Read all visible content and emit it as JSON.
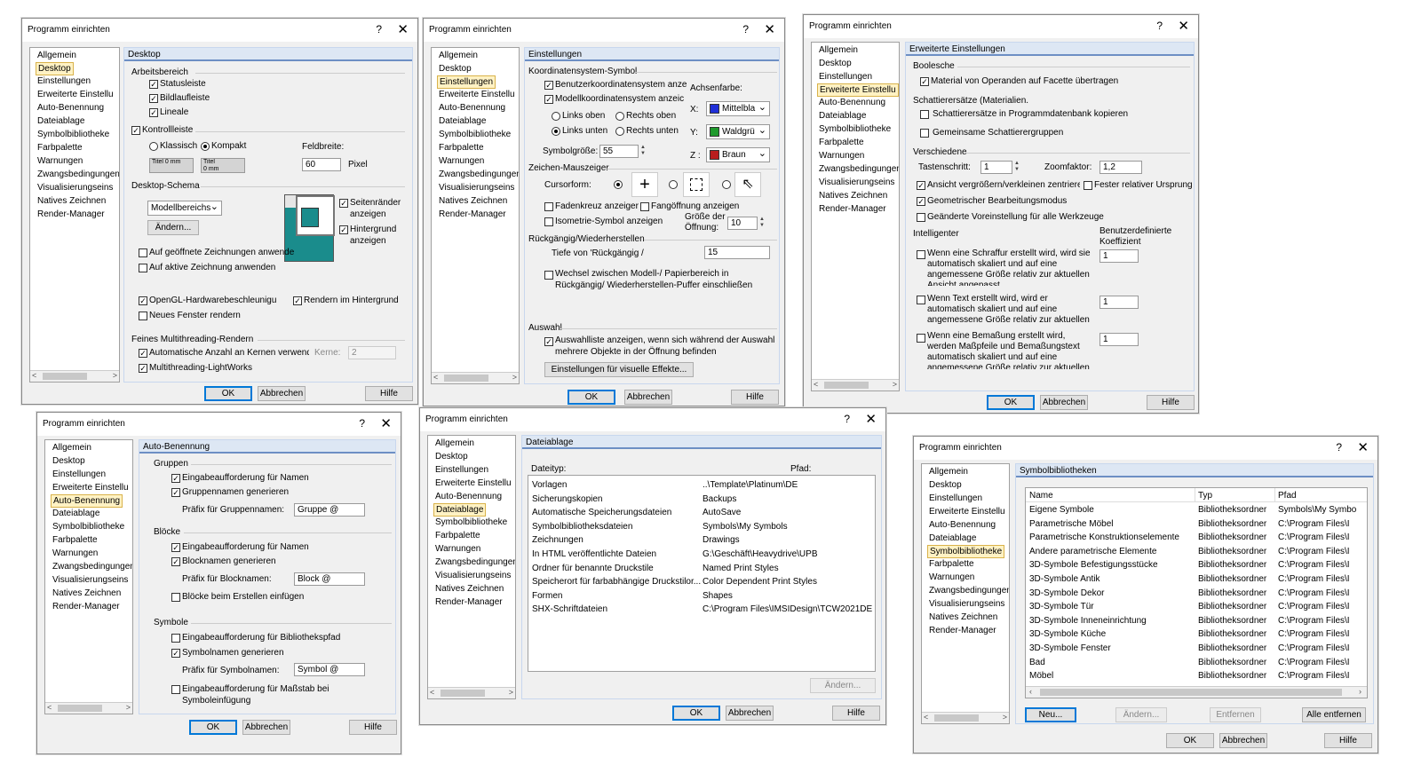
{
  "common": {
    "title": "Programm einrichten",
    "help": "?",
    "close": "✕",
    "ok": "OK",
    "cancel": "Abbrechen",
    "hilfe": "Hilfe"
  },
  "nav": [
    "Allgemein",
    "Desktop",
    "Einstellungen",
    "Erweiterte Einstellu",
    "Auto-Benennung",
    "Dateiablage",
    "Symbolbibliotheke",
    "Farbpalette",
    "Warnungen",
    "Zwangsbedingungen",
    "Visualisierungseins",
    "Natives Zeichnen",
    "Render-Manager"
  ],
  "nav_short": {
    "symbol": "Symbolbiblioth",
    "zwang": "Zwangsbedingung"
  },
  "d1": {
    "heading": "Desktop",
    "arbeitsbereich": "Arbeitsbereich",
    "statusleiste": "Statusleiste",
    "bildlauf": "Bildlaufleiste",
    "lineale": "Lineale",
    "kontroll": "Kontrollleiste",
    "klassisch": "Klassisch",
    "kompakt": "Kompakt",
    "feldbreite": "Feldbreite:",
    "feld_val": "60",
    "pixel": "Pixel",
    "titel": "Titel",
    "mm": "0 mm",
    "schema": "Desktop-Schema",
    "schema_val": "Modellbereichs",
    "aendern": "Ändern...",
    "seitenraender": "Seitenränder",
    "anzeigen": "anzeigen",
    "hintergrund": "Hintergrund",
    "geoeffnete": "Auf geöffnete Zeichnungen anwende",
    "aktive": "Auf aktive Zeichnung anwenden",
    "opengl": "OpenGL-Hardwarebeschleunigu",
    "render_hg": "Rendern im Hintergrund",
    "neues": "Neues Fenster rendern",
    "feines": "Feines Multithreading-Rendern",
    "auto_kerne": "Automatische Anzahl an Kernen verwende",
    "kerne": "Kerne:",
    "kerne_val": "2",
    "multi": "Multithreading-LightWorks"
  },
  "d2": {
    "heading": "Einstellungen",
    "koord": "Koordinatensystem-Symbol",
    "benutzer": "Benutzerkoordinatensystem anzeic",
    "modell": "Modellkoordinatensystem anzeic",
    "achsen": "Achsenfarbe:",
    "lo": "Links oben",
    "ro": "Rechts oben",
    "lu": "Links unten",
    "ru": "Rechts unten",
    "x": "X:",
    "y": "Y:",
    "z": "Z :",
    "xc": "Mittelbla",
    "yc": "Waldgrü",
    "zc": "Braun",
    "xcol": "#1f2fd8",
    "ycol": "#1e9a2c",
    "zcol": "#b81d1d",
    "symgr": "Symbolgröße:",
    "symgr_val": "55",
    "zeichen": "Zeichen-Mauszeiger",
    "cursor": "Cursorform:",
    "faden": "Fadenkreuz anzeiger",
    "fang": "Fangöffnung anzeigen",
    "iso": "Isometrie-Symbol anzeigen",
    "groesse": "Größe der",
    "oeffnung": "Öffnung:",
    "oeff_val": "10",
    "rueck": "Rückgängig/Wiederherstellen",
    "tiefe": "Tiefe von 'Rückgängig /",
    "tiefe_val": "15",
    "wechsel1": "Wechsel zwischen Modell-/ Papierbereich in",
    "wechsel2": "Rückgängig/ Wiederherstellen-Puffer einschließen",
    "auswahl": "Auswahl",
    "liste1": "Auswahlliste anzeigen, wenn sich während der Auswahl",
    "liste2": "mehrere Objekte in der Öffnung befinden",
    "visuell": "Einstellungen für visuelle Effekte..."
  },
  "d3": {
    "heading": "Erweiterte Einstellungen",
    "boolesche": "Boolesche",
    "material": "Material von Operanden auf Facette übertragen",
    "schatt": "Schattierersätze (Materialien.",
    "schatt_kop": "Schattierersätze in Programmdatenbank kopieren",
    "gemeinsam": "Gemeinsame Schattierergruppen",
    "versch": "Verschiedene",
    "tasten": "Tastenschritt:",
    "tasten_val": "1",
    "zoom": "Zoomfaktor:",
    "zoom_val": "1,2",
    "ansicht": "Ansicht vergrößern/verkleinen zentriere",
    "fester": "Fester relativer Ursprung",
    "geom": "Geometrischer Bearbeitungsmodus",
    "geaendert": "Geänderte Voreinstellung für alle Werkzeuge",
    "intell": "Intelligenter",
    "benutzerdef": "Benutzerdefinierte",
    "koeff": "Koeffizient",
    "s1": [
      "Wenn eine Schraffur erstellt wird, wird sie",
      "automatisch skaliert und auf eine",
      "angemessene Größe relativ zur aktuellen",
      "Ansicht angepasst"
    ],
    "s2": [
      "Wenn Text erstellt wird, wird er",
      "automatisch skaliert und auf eine",
      "angemessene Größe relativ zur aktuellen"
    ],
    "s3": [
      "Wenn eine Bemaßung erstellt wird,",
      "werden Maßpfeile und Bemaßungstext",
      "automatisch skaliert und auf eine",
      "angemessene Größe relativ zur aktuellen"
    ],
    "k1": "1",
    "k2": "1",
    "k3": "1"
  },
  "d4": {
    "heading": "Auto-Benennung",
    "gruppen": "Gruppen",
    "eingabe": "Eingabeaufforderung für Namen",
    "gruppengen": "Gruppennamen generieren",
    "praefix_g": "Präfix für Gruppennamen:",
    "praefix_g_val": "Gruppe @",
    "bloecke": "Blöcke",
    "eingabe2": "Eingabeaufforderung für Namen",
    "blockgen": "Blocknamen generieren",
    "praefix_b": "Präfix für Blocknamen:",
    "praefix_b_val": "Block @",
    "bloecke_einf": "Blöcke beim Erstellen einfügen",
    "symbole": "Symbole",
    "bibpfad": "Eingabeaufforderung für Bibliothekspfad",
    "symgen": "Symbolnamen generieren",
    "praefix_s": "Präfix für Symbolnamen:",
    "praefix_s_val": "Symbol @",
    "masstab1": "Eingabeaufforderung für Maßstab bei",
    "masstab2": "Symboleinfügung"
  },
  "d5": {
    "heading": "Dateiablage",
    "col_typ": "Dateityp:",
    "col_pfad": "Pfad:",
    "rows": [
      [
        "Vorlagen",
        "..\\Template\\Platinum\\DE"
      ],
      [
        "Sicherungskopien",
        "Backups"
      ],
      [
        "Automatische Speicherungsdateien",
        "AutoSave"
      ],
      [
        "Symbolbibliotheksdateien",
        "Symbols\\My Symbols"
      ],
      [
        "Zeichnungen",
        "Drawings"
      ],
      [
        "In HTML veröffentlichte Dateien",
        "G:\\Geschäft\\Heavydrive\\UPB"
      ],
      [
        "Ordner für benannte Druckstile",
        "Named Print Styles"
      ],
      [
        "Speicherort für farbabhängige Druckstilor...",
        "Color Dependent Print Styles"
      ],
      [
        "Formen",
        "Shapes"
      ],
      [
        "SHX-Schriftdateien",
        "C:\\Program Files\\IMSIDesign\\TCW2021DE..."
      ]
    ],
    "aendern": "Ändern..."
  },
  "d6": {
    "heading": "Symbolbibliotheken",
    "cols": [
      "Name",
      "Typ",
      "Pfad"
    ],
    "rows": [
      [
        "Eigene Symbole",
        "Bibliotheksordner",
        "Symbols\\My Symbo"
      ],
      [
        "Parametrische Möbel",
        "Bibliotheksordner",
        "C:\\Program Files\\I"
      ],
      [
        "Parametrische Konstruktionselemente",
        "Bibliotheksordner",
        "C:\\Program Files\\I"
      ],
      [
        "Andere parametrische Elemente",
        "Bibliotheksordner",
        "C:\\Program Files\\I"
      ],
      [
        "3D-Symbole Befestigungsstücke",
        "Bibliotheksordner",
        "C:\\Program Files\\I"
      ],
      [
        "3D-Symbole Antik",
        "Bibliotheksordner",
        "C:\\Program Files\\I"
      ],
      [
        "3D-Symbole Dekor",
        "Bibliotheksordner",
        "C:\\Program Files\\I"
      ],
      [
        "3D-Symbole Tür",
        "Bibliotheksordner",
        "C:\\Program Files\\I"
      ],
      [
        "3D-Symbole Inneneinrichtung",
        "Bibliotheksordner",
        "C:\\Program Files\\I"
      ],
      [
        "3D-Symbole Küche",
        "Bibliotheksordner",
        "C:\\Program Files\\I"
      ],
      [
        "3D-Symbole Fenster",
        "Bibliotheksordner",
        "C:\\Program Files\\I"
      ],
      [
        "Bad",
        "Bibliotheksordner",
        "C:\\Program Files\\I"
      ],
      [
        "Möbel",
        "Bibliotheksordner",
        "C:\\Program Files\\I"
      ]
    ],
    "neu": "Neu...",
    "aendern": "Ändern...",
    "entfernen": "Entfernen",
    "alle": "Alle entfernen"
  }
}
